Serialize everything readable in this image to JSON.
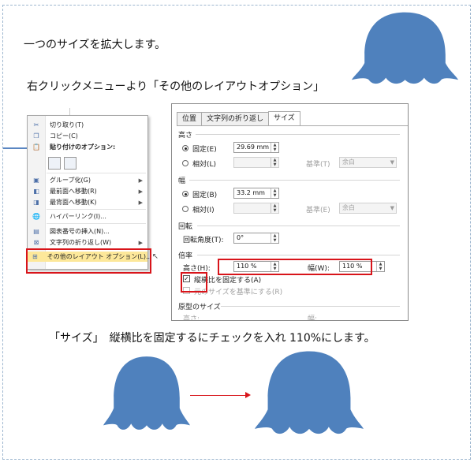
{
  "captions": {
    "line1": "一つのサイズを拡大します。",
    "line2": "右クリックメニューより「その他のレイアウトオプション」",
    "line3": "「サイズ」　縦横比を固定するにチェックを入れ 110%にします。"
  },
  "colors": {
    "shape": "#4f81bd",
    "highlight_box": "#d8141a",
    "menu_highlight": "#fde89a"
  },
  "context_menu": {
    "items": [
      {
        "label": "切り取り(T)",
        "icon": "scissors-icon"
      },
      {
        "label": "コピー(C)",
        "icon": "copy-icon"
      },
      {
        "label": "貼り付けのオプション:",
        "icon": "clipboard-icon"
      },
      {
        "label": "グループ化(G)",
        "icon": "group-icon",
        "submenu": true
      },
      {
        "label": "最前面へ移動(R)",
        "icon": "bring-front-icon",
        "submenu": true
      },
      {
        "label": "最背面へ移動(K)",
        "icon": "send-back-icon",
        "submenu": true
      },
      {
        "label": "ハイパーリンク(I)...",
        "icon": "hyperlink-icon"
      },
      {
        "label": "図表番号の挿入(N)...",
        "icon": "caption-icon"
      },
      {
        "label": "文字列の折り返し(W)",
        "icon": "wrap-text-icon",
        "submenu": true
      },
      {
        "label": "その他のレイアウト オプション(L)...",
        "icon": "layout-options-icon",
        "highlighted": true
      }
    ]
  },
  "dialog": {
    "tabs": [
      "位置",
      "文字列の折り返し",
      "サイズ"
    ],
    "active_tab": "サイズ",
    "height": {
      "title": "高さ",
      "fixed_label": "固定(E)",
      "fixed_value": "29.69 mm",
      "relative_label": "相対(L)",
      "basis_label": "基準(T)",
      "basis_value": "余白"
    },
    "width": {
      "title": "幅",
      "fixed_label": "固定(B)",
      "fixed_value": "33.2 mm",
      "relative_label": "相対(I)",
      "basis_label": "基準(E)",
      "basis_value": "余白"
    },
    "rotation": {
      "title": "回転",
      "angle_label": "回転角度(T):",
      "angle_value": "0°"
    },
    "scale": {
      "title": "倍率",
      "height_label": "高さ(H):",
      "height_value": "110 %",
      "width_label": "幅(W):",
      "width_value": "110 %",
      "lock_label": "縦横比を固定する(A)",
      "lock_checked": true,
      "relative_label": "元のサイズを基準にする(R)"
    },
    "original": {
      "title": "原型のサイズ",
      "height_label": "高さ:",
      "width_label": "幅:"
    }
  }
}
